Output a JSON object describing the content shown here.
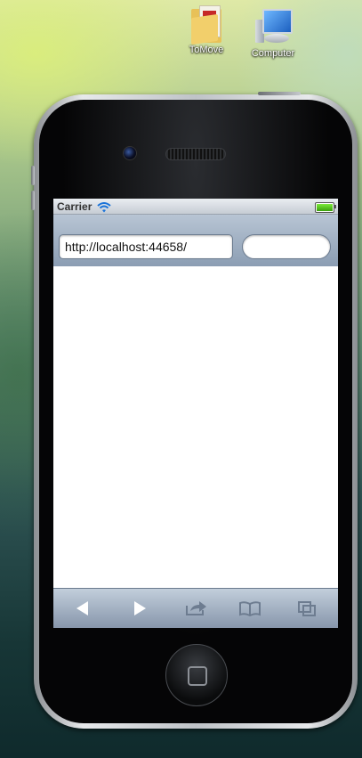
{
  "desktop": {
    "icons": [
      {
        "label": "ToMove",
        "icon": "folder-icon"
      },
      {
        "label": "Computer",
        "icon": "computer-icon"
      }
    ]
  },
  "simulator": {
    "status_bar": {
      "carrier": "Carrier",
      "wifi_icon": "wifi-icon",
      "battery_icon": "battery-icon",
      "battery_level": 1.0
    },
    "nav_bar": {
      "url_value": "http://localhost:44658/",
      "search_placeholder": ""
    },
    "toolbar": {
      "items": [
        {
          "icon": "back-arrow-icon"
        },
        {
          "icon": "forward-arrow-icon"
        },
        {
          "icon": "share-icon"
        },
        {
          "icon": "bookmarks-icon"
        },
        {
          "icon": "tabs-icon"
        }
      ]
    },
    "colors": {
      "battery_green": "#5cc81f",
      "toolbar_blue": "#8796ab"
    }
  }
}
